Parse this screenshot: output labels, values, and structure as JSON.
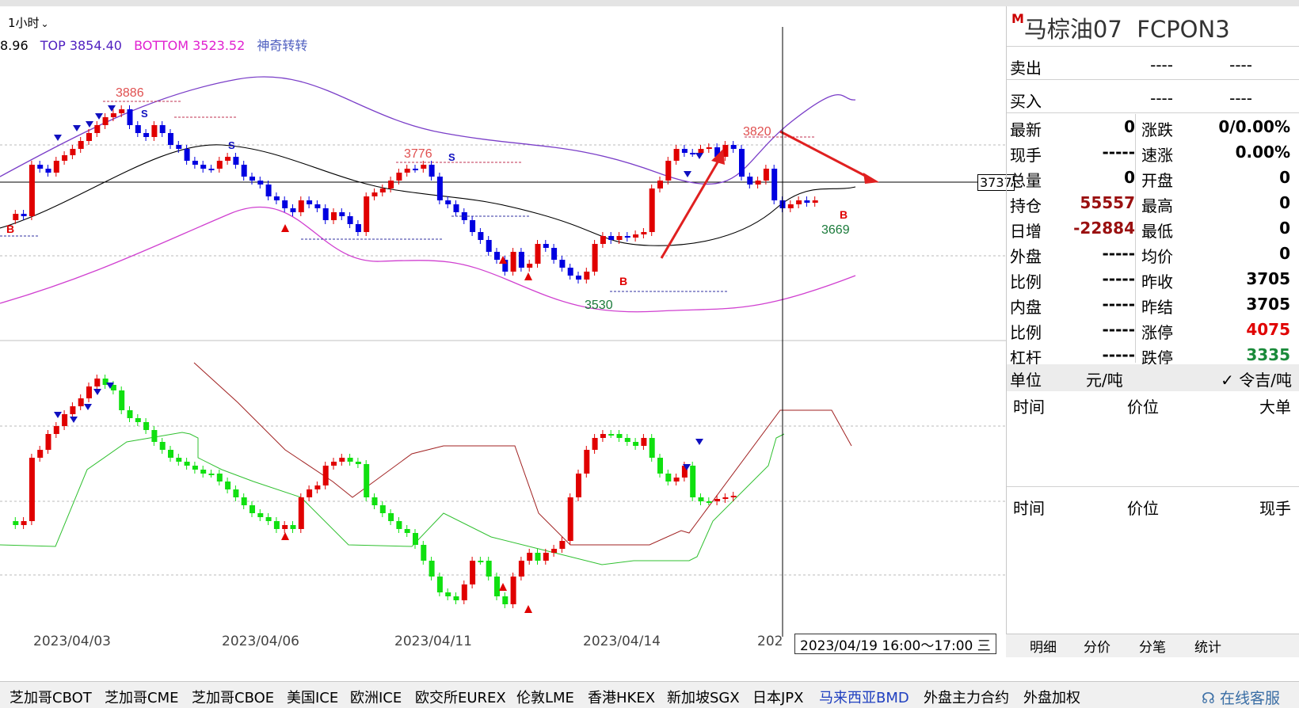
{
  "toolbar": {
    "period": "1小时"
  },
  "legend": {
    "partial": "8.96",
    "top": "TOP 3854.40",
    "bottom": "BOTTOM 3523.52",
    "indicator": "神奇转转"
  },
  "chart_annotations": {
    "price_tag": "3737",
    "high1": "3886",
    "high2": "3776",
    "high3": "3820",
    "low1": "3530",
    "low2": "3669",
    "signal_b": "B",
    "signal_s": "S"
  },
  "colors": {
    "up": "#e00000",
    "down": "#0000e0",
    "up2": "#ff0000",
    "down2": "#00dd00",
    "upper_band": "#7a3ec8",
    "lower_band": "#d040d0",
    "mid": "#000000",
    "accent": "#d02020"
  },
  "xaxis": [
    "2023/04/03",
    "2023/04/06",
    "2023/04/11",
    "2023/04/14",
    "202"
  ],
  "crosshair_time": "2023/04/19 16:00～17:00 三",
  "panel": {
    "title_mark": "M",
    "name": "马棕油07",
    "code": "FCPON3",
    "sell_label": "卖出",
    "sell_v1": "----",
    "sell_v2": "----",
    "buy_label": "买入",
    "buy_v1": "----",
    "buy_v2": "----",
    "stats": [
      {
        "l": "最新",
        "v": "0",
        "l2": "涨跌",
        "v2": "0/0.00%"
      },
      {
        "l": "现手",
        "v": "-----",
        "l2": "速涨",
        "v2": "0.00%"
      },
      {
        "l": "总量",
        "v": "0",
        "l2": "开盘",
        "v2": "0"
      },
      {
        "l": "持仓",
        "v": "55557",
        "l2": "最高",
        "v2": "0"
      },
      {
        "l": "日增",
        "v": "-22884",
        "l2": "最低",
        "v2": "0"
      },
      {
        "l": "外盘",
        "v": "-----",
        "l2": "均价",
        "v2": "0"
      },
      {
        "l": "比例",
        "v": "-----",
        "l2": "昨收",
        "v2": "3705"
      },
      {
        "l": "内盘",
        "v": "-----",
        "l2": "昨结",
        "v2": "3705"
      },
      {
        "l": "比例",
        "v": "-----",
        "l2": "涨停",
        "v2": "4075"
      },
      {
        "l": "杠杆",
        "v": "-----",
        "l2": "跌停",
        "v2": "3335"
      }
    ],
    "unit_label": "单位",
    "unit_value": "元/吨",
    "unit_alt": "✓ 令吉/吨",
    "list1": {
      "c1": "时间",
      "c2": "价位",
      "c3": "大单"
    },
    "list2": {
      "c1": "时间",
      "c2": "价位",
      "c3": "现手"
    },
    "tabs": [
      "明细",
      "分价",
      "分笔",
      "统计"
    ]
  },
  "footer": [
    "芝加哥CBOT",
    "芝加哥CME",
    "芝加哥CBOE",
    "美国ICE",
    "欧洲ICE",
    "欧交所EUREX",
    "伦敦LME",
    "香港HKEX",
    "新加坡SGX",
    "日本JPX",
    "马来西亚BMD",
    "外盘主力合约",
    "外盘加权"
  ],
  "service": "在线客服"
}
